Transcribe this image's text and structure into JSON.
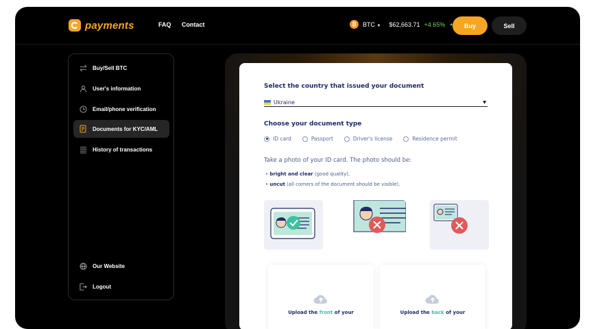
{
  "header": {
    "logo_text": "payments",
    "nav": [
      "FAQ",
      "Contact"
    ],
    "ticker": {
      "symbol": "BTC",
      "price": "$62,663.71",
      "change": "+4.65%"
    },
    "buy_label": "Buy",
    "sell_label": "Sell"
  },
  "sidebar": {
    "items": [
      {
        "label": "Buy/Sell BTC",
        "icon": "swap-arrows-icon"
      },
      {
        "label": "User's information",
        "icon": "user-icon"
      },
      {
        "label": "Email/phone verification",
        "icon": "clock-icon"
      },
      {
        "label": "Documents for KYC/AML",
        "icon": "document-icon",
        "active": true
      },
      {
        "label": "History of transactions",
        "icon": "list-icon"
      }
    ],
    "bottom_items": [
      {
        "label": "Our Website",
        "icon": "globe-icon"
      },
      {
        "label": "Logout",
        "icon": "logout-icon"
      }
    ]
  },
  "form": {
    "country_title": "Select the country that issued your document",
    "country_value": "Ukraine",
    "doc_type_title": "Choose your document type",
    "doc_types": [
      "ID card",
      "Passport",
      "Driver's license",
      "Residence permit"
    ],
    "selected_doc_type": "ID card",
    "photo_intro": "Take a photo of your ID card. The photo should be:",
    "requirements": [
      {
        "bold": "bright and clear",
        "rest": " (good quality),"
      },
      {
        "bold": "uncut",
        "rest": " (all corners of the document should be visible)."
      }
    ],
    "upload_front": {
      "pre": "Upload the ",
      "hl": "front",
      "post": " of your"
    },
    "upload_back": {
      "pre": "Upload the ",
      "hl": "back",
      "post": " of your"
    }
  },
  "colors": {
    "accent": "#f5a623",
    "positive": "#6fd36a",
    "navy": "#1f2a6b",
    "teal": "#3fc1a0",
    "error": "#e05a5a"
  }
}
